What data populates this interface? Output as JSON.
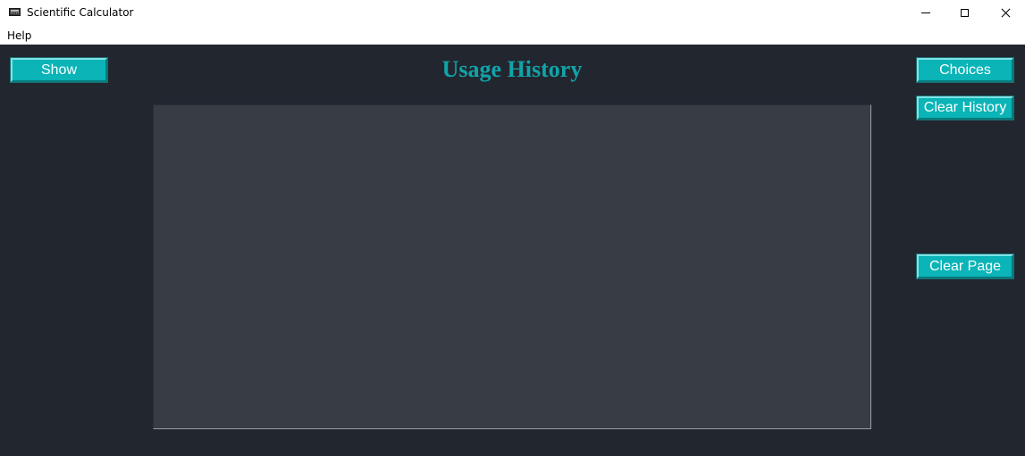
{
  "window": {
    "title": "Scientific Calculator",
    "icon": "calculator-icon"
  },
  "menu": {
    "items": [
      "Help"
    ]
  },
  "main": {
    "heading": "Usage History",
    "history_text": "",
    "colors": {
      "background": "#21262f",
      "button": "#0ab4b7",
      "heading": "#12a3a8",
      "history_area": "#383c45"
    }
  },
  "buttons": {
    "show": "Show",
    "choices": "Choices",
    "clear_history": "Clear History",
    "clear_page": "Clear Page"
  }
}
